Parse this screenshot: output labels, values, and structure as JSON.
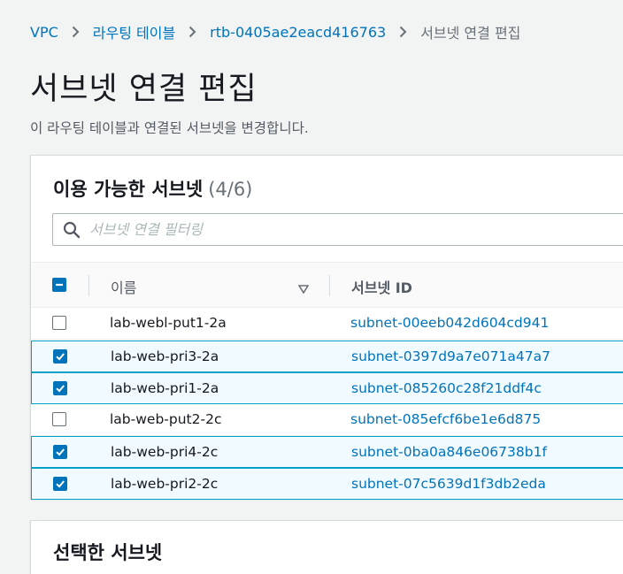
{
  "breadcrumb": {
    "items": [
      "VPC",
      "라우팅 테이블",
      "rtb-0405ae2eacd416763"
    ],
    "current": "서브넷 연결 편집"
  },
  "page": {
    "title": "서브넷 연결 편집",
    "description": "이 라우팅 테이블과 연결된 서브넷을 변경합니다."
  },
  "available_panel": {
    "title": "이용 가능한 서브넷",
    "count": "(4/6)",
    "search_placeholder": "서브넷 연결 필터링",
    "columns": {
      "name": "이름",
      "subnet_id": "서브넷 ID"
    },
    "rows": [
      {
        "name": "lab-webl-put1-2a",
        "subnet_id": "subnet-00eeb042d604cd941",
        "checked": false
      },
      {
        "name": "lab-web-pri3-2a",
        "subnet_id": "subnet-0397d9a7e071a47a7",
        "checked": true
      },
      {
        "name": "lab-web-pri1-2a",
        "subnet_id": "subnet-085260c28f21ddf4c",
        "checked": true
      },
      {
        "name": "lab-web-put2-2c",
        "subnet_id": "subnet-085efcf6be1e6d875",
        "checked": false
      },
      {
        "name": "lab-web-pri4-2c",
        "subnet_id": "subnet-0ba0a846e06738b1f",
        "checked": true
      },
      {
        "name": "lab-web-pri2-2c",
        "subnet_id": "subnet-07c5639d1f3db2eda",
        "checked": true
      }
    ]
  },
  "selected_panel": {
    "title": "선택한 서브넷"
  },
  "colors": {
    "link": "#0073bb",
    "selected_border": "#00a1c9",
    "selected_bg": "#f1faff"
  },
  "icons": {
    "search": "search-icon",
    "separator": "chevron-right-icon",
    "sort": "sort-down-icon"
  }
}
